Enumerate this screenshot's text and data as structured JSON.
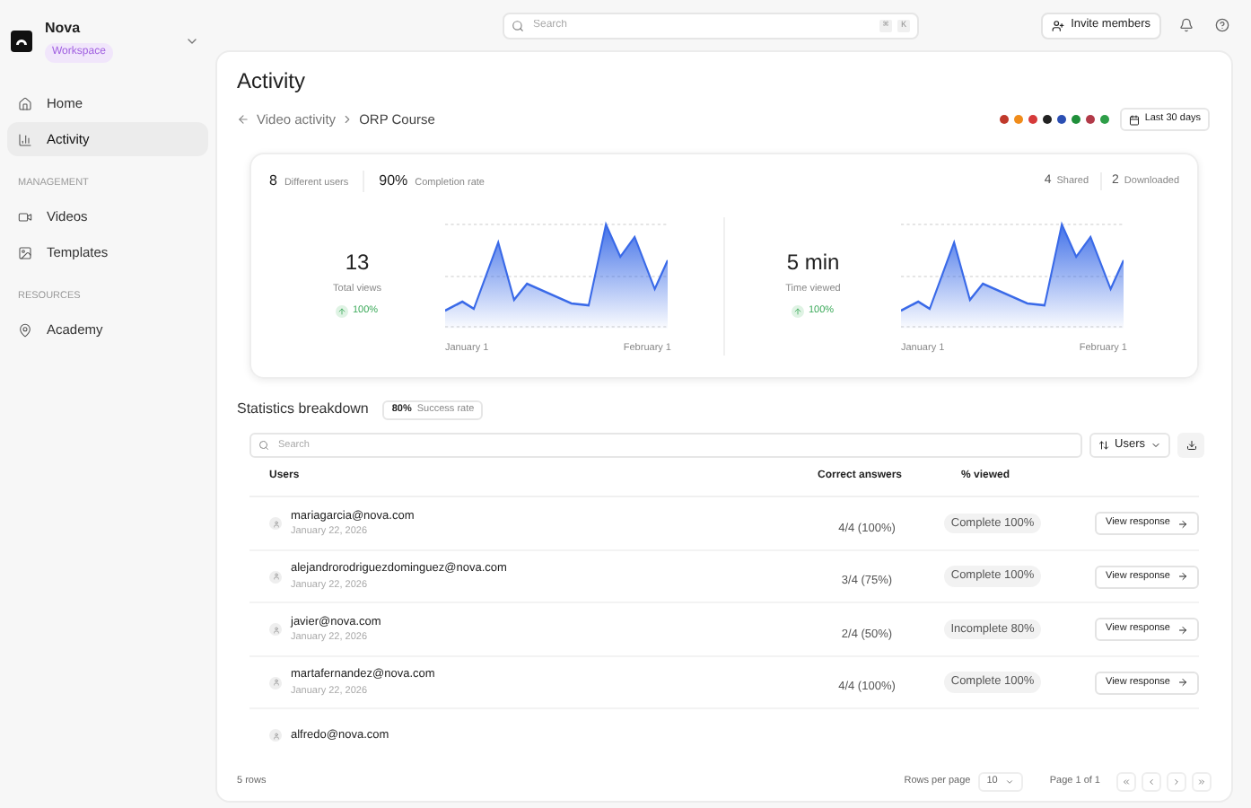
{
  "workspace": {
    "name": "Nova",
    "badge": "Workspace"
  },
  "search": {
    "placeholder": "Search",
    "shortcut": [
      "⌘",
      "K"
    ]
  },
  "invite_button": "Invite members",
  "sidebar": {
    "items": [
      {
        "label": "Home",
        "kind": "home",
        "selected": false
      },
      {
        "label": "Activity",
        "kind": "chart",
        "selected": true
      }
    ],
    "sections": [
      {
        "title": "MANAGEMENT",
        "items": [
          {
            "label": "Videos",
            "kind": "video",
            "selected": false
          },
          {
            "label": "Templates",
            "kind": "template",
            "selected": false
          }
        ]
      },
      {
        "title": "RESOURCES",
        "items": [
          {
            "label": "Academy",
            "kind": "pin",
            "selected": false
          }
        ]
      }
    ]
  },
  "page_title": "Activity",
  "breadcrumb": [
    "Video activity",
    "ORP Course"
  ],
  "flags": [
    {
      "color": "#c0392b"
    },
    {
      "color": "#f08c1a"
    },
    {
      "color": "#d63a3a"
    },
    {
      "color": "#222222"
    },
    {
      "color": "#2b4fb3"
    },
    {
      "color": "#1f8f3a"
    },
    {
      "color": "#b23a48"
    },
    {
      "color": "#2e9e48"
    }
  ],
  "date_range": "Last 30 days",
  "summary": [
    {
      "value": "8",
      "label": "Different users"
    },
    {
      "value": "90%",
      "label": "Completion rate"
    }
  ],
  "summary_right": [
    {
      "value": "4",
      "label": "Shared"
    },
    {
      "value": "2",
      "label": "Downloaded"
    }
  ],
  "metrics": [
    {
      "value": "13",
      "label": "Total views",
      "change": "100%",
      "x_start": "January 1",
      "x_end": "February 1"
    },
    {
      "value": "5 min",
      "label": "Time viewed",
      "change": "100%",
      "x_start": "January 1",
      "x_end": "February 1"
    }
  ],
  "breakdown": {
    "title": "Statistics breakdown",
    "rate_value": "80%",
    "rate_label": "Success rate"
  },
  "table_search": {
    "placeholder": "Search"
  },
  "filter": "Users",
  "table": {
    "columns": [
      "Users",
      "Correct answers",
      "% viewed"
    ],
    "rows": [
      {
        "email": "mariagarcia@nova.com",
        "date": "January 22, 2026",
        "correct": "4/4 (100%)",
        "viewed": "Complete 100%",
        "action": "View response"
      },
      {
        "email": "alejandrorodriguezdominguez@nova.com",
        "date": "January 22, 2026",
        "correct": "3/4 (75%)",
        "viewed": "Complete 100%",
        "action": "View response"
      },
      {
        "email": "javier@nova.com",
        "date": "January 22, 2026",
        "correct": "2/4 (50%)",
        "viewed": "Incomplete 80%",
        "action": "View response"
      },
      {
        "email": "martafernandez@nova.com",
        "date": "January 22, 2026",
        "correct": "4/4 (100%)",
        "viewed": "Complete 100%",
        "action": "View response"
      },
      {
        "email": "alfredo@nova.com"
      }
    ]
  },
  "footer": {
    "count": "5 rows",
    "rows_per_page_label": "Rows per page",
    "rows_per_page": "10",
    "page": "Page 1 of 1"
  }
}
